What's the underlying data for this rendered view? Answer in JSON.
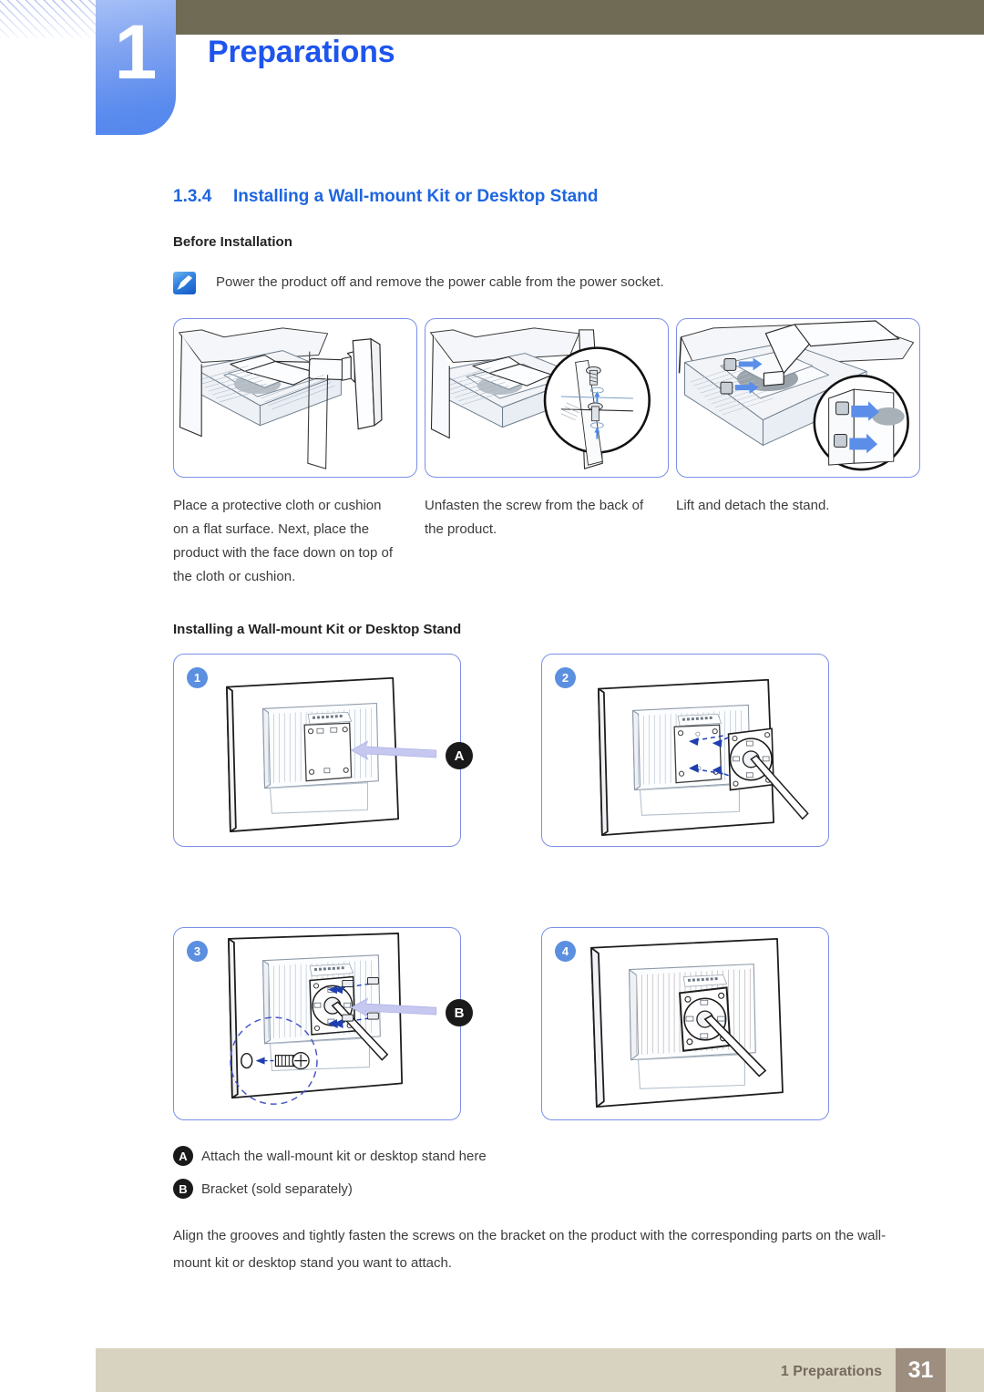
{
  "header": {
    "chapter_number": "1",
    "chapter_title": "Preparations",
    "accent_blue": "#1e55ee",
    "tab_blue": "#5a8bee",
    "olive": "#6f6b55"
  },
  "section": {
    "number": "1.3.4",
    "title": "Installing a Wall-mount Kit or Desktop Stand"
  },
  "before_installation": {
    "heading": "Before Installation",
    "note_icon": "note-pen-icon",
    "note_text": "Power the product off and remove the power cable from the power socket."
  },
  "removal_panels": [
    {
      "alt": "monitor-face-down-on-cushion-illustration",
      "caption": "Place a protective cloth or cushion on a flat surface. Next, place the product with the face down on top of the cloth or cushion."
    },
    {
      "alt": "unfasten-screw-back-of-product-illustration",
      "caption": "Unfasten the screw from the back of the product."
    },
    {
      "alt": "lift-and-detach-stand-illustration",
      "caption": "Lift and detach the stand."
    }
  ],
  "install_section": {
    "heading": "Installing a Wall-mount Kit or Desktop Stand",
    "steps": [
      {
        "badge": "1",
        "alt": "monitor-back-mount-plate-illustration",
        "label": "A"
      },
      {
        "badge": "2",
        "alt": "align-bracket-with-mount-holes-illustration",
        "label": ""
      },
      {
        "badge": "3",
        "alt": "fasten-screws-on-bracket-illustration",
        "label": "B"
      },
      {
        "badge": "4",
        "alt": "bracket-attached-complete-illustration",
        "label": ""
      }
    ],
    "legend": [
      {
        "key": "A",
        "text": "Attach the wall-mount kit or desktop stand here"
      },
      {
        "key": "B",
        "text": "Bracket (sold separately)"
      }
    ],
    "body_text": "Align the grooves and tightly fasten the screws on the bracket on the product with the corresponding parts on the wall-mount kit or desktop stand you want to attach."
  },
  "footer": {
    "label": "1 Preparations",
    "page_number": "31",
    "bar_color": "#d8d3c0",
    "page_box_color": "#9d8e80"
  }
}
